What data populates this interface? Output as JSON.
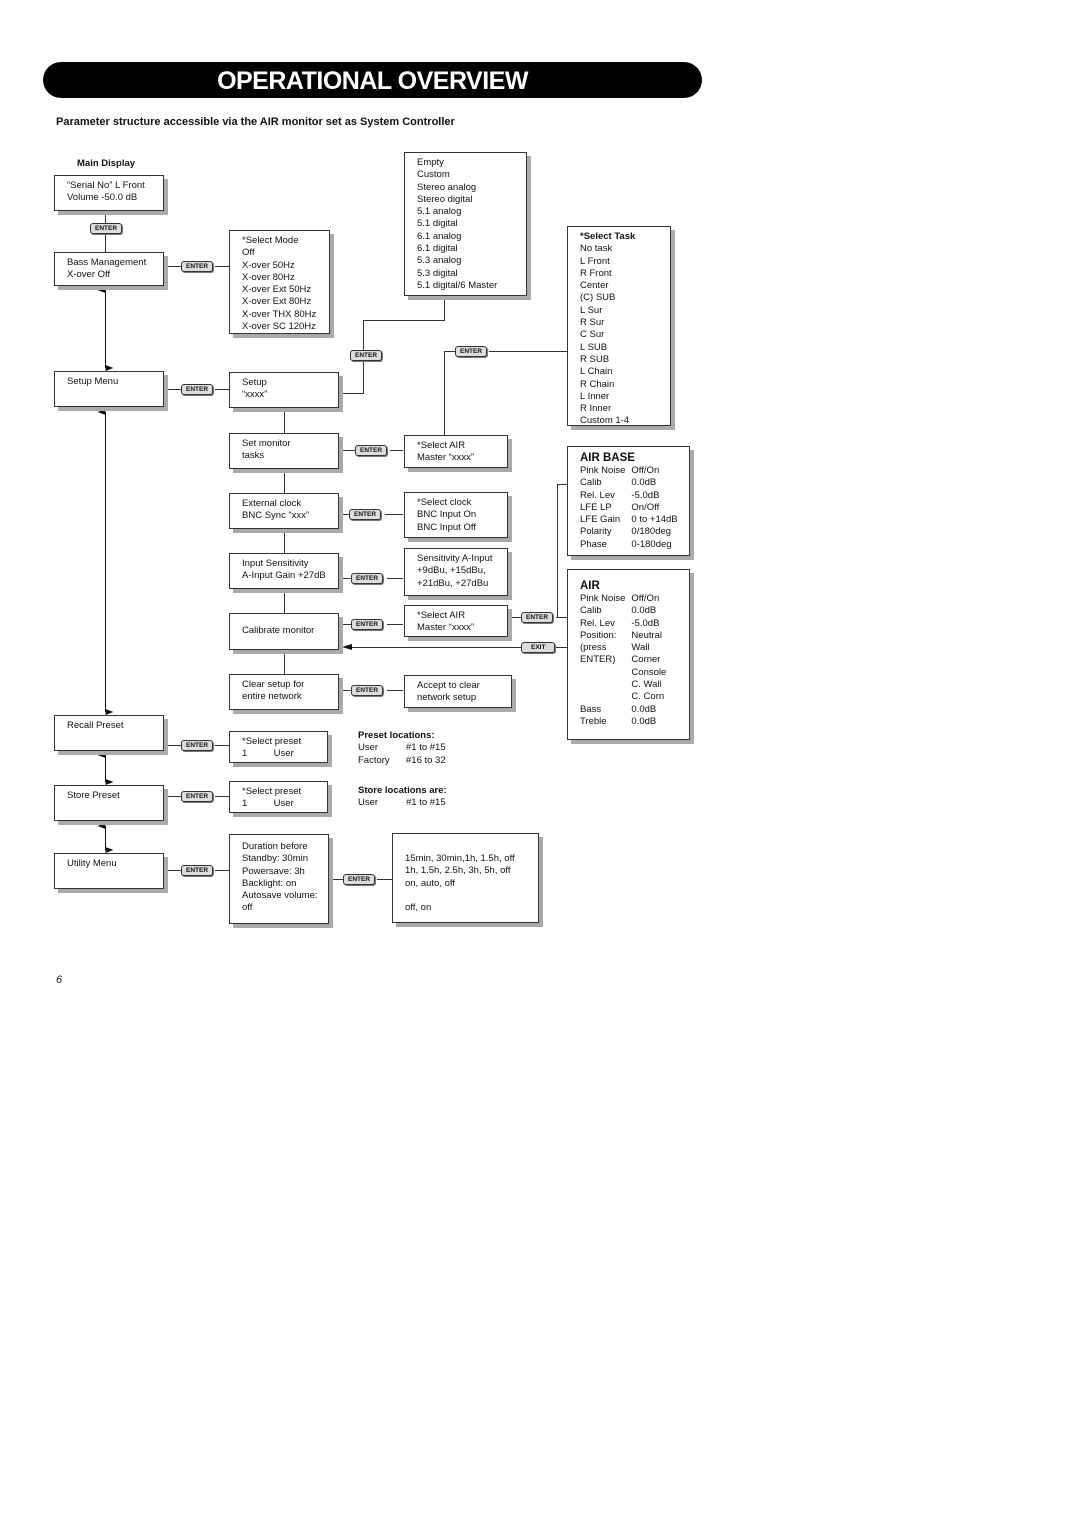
{
  "page": {
    "title": "OPERATIONAL OVERVIEW",
    "subtitle": "Parameter structure accessible via the AIR monitor set as System Controller",
    "page_number": "6"
  },
  "keys": {
    "enter": "ENTER",
    "exit": "EXIT"
  },
  "main_column": {
    "heading": "Main Display",
    "main_display": [
      "“Serial No”   L Front",
      "Volume -50.0 dB"
    ],
    "bass_management": [
      "Bass Management",
      "X-over Off"
    ],
    "setup_menu": [
      "Setup Menu"
    ],
    "recall_preset": [
      "Recall Preset"
    ],
    "store_preset": [
      "Store Preset"
    ],
    "utility_menu": [
      "Utility Menu"
    ]
  },
  "bass_modes": [
    "*Select Mode",
    "Off",
    "X-over 50Hz",
    "X-over 80Hz",
    "X-over Ext 50Hz",
    "X-over Ext 80Hz",
    "X-over THX 80Hz",
    "X-over SC 120Hz"
  ],
  "setup_options": [
    "Empty",
    "Custom",
    "Stereo analog",
    "Stereo digital",
    "5.1 analog",
    "5.1 digital",
    "6.1 analog",
    "6.1 digital",
    "5.3 analog",
    "5.3 digital",
    "5.1 digital/6 Master"
  ],
  "select_task": {
    "title": "*Select Task",
    "items": [
      "No task",
      "L Front",
      "R Front",
      "Center",
      "(C) SUB",
      "L Sur",
      "R Sur",
      "C Sur",
      "L SUB",
      "R SUB",
      "L Chain",
      "R Chain",
      "L Inner",
      "R Inner",
      "Custom 1-4"
    ]
  },
  "setup_column": {
    "setup": [
      "Setup",
      "“xxxx”"
    ],
    "set_monitor_tasks": [
      "Set monitor",
      "tasks"
    ],
    "external_clock": [
      "External clock",
      "BNC Sync “xxx”"
    ],
    "input_sensitivity": [
      "Input Sensitivity",
      "A-Input Gain  +27dB"
    ],
    "calibrate_monitor": [
      "Calibrate monitor"
    ],
    "clear_setup": [
      "Clear setup for",
      "entire network"
    ]
  },
  "sub_column": {
    "select_air_master_1": [
      "*Select AIR",
      "Master “xxxx”"
    ],
    "select_clock": [
      "*Select clock",
      "BNC Input On",
      "BNC Input Off"
    ],
    "sensitivity": [
      "Sensitivity A-Input",
      "+9dBu, +15dBu,",
      "+21dBu, +27dBu"
    ],
    "select_air_master_2": [
      "*Select AIR",
      "Master “xxxx”"
    ],
    "accept_clear": [
      "Accept to clear",
      "network setup"
    ]
  },
  "air_base": {
    "title": "AIR BASE",
    "rows": [
      [
        "Pink Noise",
        "Off/On"
      ],
      [
        "Calib",
        "0.0dB"
      ],
      [
        "Rel. Lev",
        "-5.0dB"
      ],
      [
        "LFE LP",
        "On/Off"
      ],
      [
        "LFE Gain",
        "0 to +14dB"
      ],
      [
        "Polarity",
        "0/180deg"
      ],
      [
        "Phase",
        "0-180deg"
      ]
    ]
  },
  "air": {
    "title": "AIR",
    "rows": [
      [
        "Pink Noise",
        "Off/On"
      ],
      [
        "Calib",
        "0.0dB"
      ],
      [
        "Rel. Lev",
        "-5.0dB"
      ],
      [
        "Position:",
        "Neutral"
      ],
      [
        "(press",
        "Wall"
      ],
      [
        "ENTER)",
        "Corner"
      ],
      [
        "",
        "Console"
      ],
      [
        "",
        "C. Wall"
      ],
      [
        "",
        "C. Corn"
      ],
      [
        "Bass",
        "0.0dB"
      ],
      [
        "Treble",
        "0.0dB"
      ]
    ]
  },
  "presets": {
    "select_preset_recall": [
      "*Select preset",
      "1          User"
    ],
    "select_preset_store": [
      "*Select preset",
      "1          User"
    ],
    "preset_locations": {
      "title": "Preset locations:",
      "rows": [
        [
          "User",
          "#1 to #15"
        ],
        [
          "Factory",
          "#16 to 32"
        ]
      ]
    },
    "store_locations": {
      "title": "Store locations are:",
      "rows": [
        [
          "User",
          "#1 to #15"
        ]
      ]
    }
  },
  "utility": {
    "settings": [
      "Duration before",
      "Standby: 30min",
      "Powersave: 3h",
      "Backlight: on",
      "Autosave volume:",
      "off"
    ],
    "options": [
      "15min, 30min,1h, 1.5h, off",
      "1h, 1.5h, 2.5h, 3h, 5h, off",
      "on, auto, off",
      "",
      "off, on"
    ]
  }
}
